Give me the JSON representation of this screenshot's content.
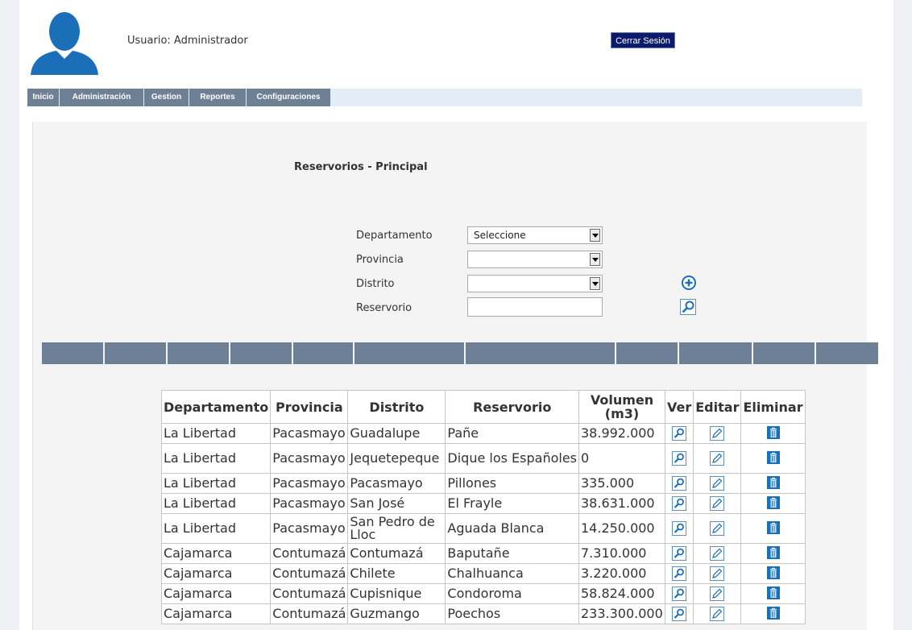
{
  "header": {
    "user_label": "Usuario: Administrador",
    "logout_label": "Cerrar Sesión"
  },
  "nav": {
    "items": [
      {
        "label": "Inicio"
      },
      {
        "label": "Administración"
      },
      {
        "label": "Gestion"
      },
      {
        "label": "Reportes"
      },
      {
        "label": "Configuraciones"
      }
    ]
  },
  "page": {
    "title": "Reservorios - Principal"
  },
  "filters": {
    "departamento_label": "Departamento",
    "departamento_value": "Seleccione",
    "provincia_label": "Provincia",
    "provincia_value": "",
    "distrito_label": "Distrito",
    "distrito_value": "",
    "reservorio_label": "Reservorio",
    "reservorio_value": ""
  },
  "icons": {
    "add": "plus-circle-icon",
    "search": "magnifier-icon",
    "view": "magnifier-icon",
    "edit": "pencil-icon",
    "delete": "trash-icon"
  },
  "colors": {
    "nav_bg": "#6e8095",
    "logout_bg": "#0c1a6b",
    "icon_blue": "#1b6fb8"
  },
  "table": {
    "headers": {
      "departamento": "Departamento",
      "provincia": "Provincia",
      "distrito": "Distrito",
      "reservorio": "Reservorio",
      "volumen": "Volumen (m3)",
      "ver": "Ver",
      "editar": "Editar",
      "eliminar": "Eliminar"
    },
    "rows": [
      {
        "departamento": "La Libertad",
        "provincia": "Pacasmayo",
        "distrito": "Guadalupe",
        "reservorio": "Pañe",
        "volumen": "38.992.000"
      },
      {
        "departamento": "La Libertad",
        "provincia": "Pacasmayo",
        "distrito": "Jequetepeque",
        "reservorio": "Dique los Españoles",
        "volumen": "0"
      },
      {
        "departamento": "La Libertad",
        "provincia": "Pacasmayo",
        "distrito": "Pacasmayo",
        "reservorio": "Pillones",
        "volumen": "335.000"
      },
      {
        "departamento": "La Libertad",
        "provincia": "Pacasmayo",
        "distrito": "San José",
        "reservorio": "El Frayle",
        "volumen": "38.631.000"
      },
      {
        "departamento": "La Libertad",
        "provincia": "Pacasmayo",
        "distrito": "San Pedro de Lloc",
        "reservorio": "Aguada Blanca",
        "volumen": "14.250.000"
      },
      {
        "departamento": "Cajamarca",
        "provincia": "Contumazá",
        "distrito": "Contumazá",
        "reservorio": "Baputañe",
        "volumen": "7.310.000"
      },
      {
        "departamento": "Cajamarca",
        "provincia": "Contumazá",
        "distrito": "Chilete",
        "reservorio": "Chalhuanca",
        "volumen": "3.220.000"
      },
      {
        "departamento": "Cajamarca",
        "provincia": "Contumazá",
        "distrito": "Cupisnique",
        "reservorio": "Condoroma",
        "volumen": "58.824.000"
      },
      {
        "departamento": "Cajamarca",
        "provincia": "Contumazá",
        "distrito": "Guzmango",
        "reservorio": "Poechos",
        "volumen": "233.300.000"
      }
    ]
  }
}
